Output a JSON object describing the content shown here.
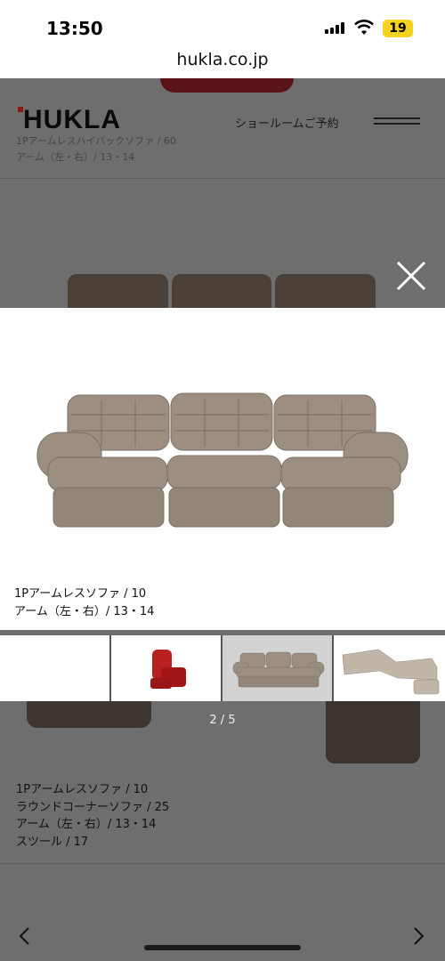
{
  "status": {
    "time": "13:50",
    "battery": "19"
  },
  "browser": {
    "url": "hukla.co.jp"
  },
  "header": {
    "logo": "HUKLA",
    "showroom_link": "ショールームご予約"
  },
  "background": {
    "caption_lines": [
      "1Pアームレスハイバックソファ / 60",
      "アーム（左・右）/ 13・14"
    ],
    "list_lines": [
      "1Pアームレスソファ / 10",
      "ラウンドコーナーソファ / 25",
      "アーム（左・右）/ 13・14",
      "スツール / 17"
    ]
  },
  "lightbox": {
    "caption_line1": "1Pアームレスソファ / 10",
    "caption_line2": "アーム（左・右）/ 13・14",
    "counter": "2 / 5"
  },
  "colors": {
    "sofa": "#9c8e80",
    "red_chair": "#b82020",
    "overlay": "#6e6e6e"
  },
  "icons": [
    "close-icon",
    "menu-icon",
    "chevron-left-icon",
    "chevron-right-icon",
    "wifi-icon",
    "signal-icon"
  ]
}
